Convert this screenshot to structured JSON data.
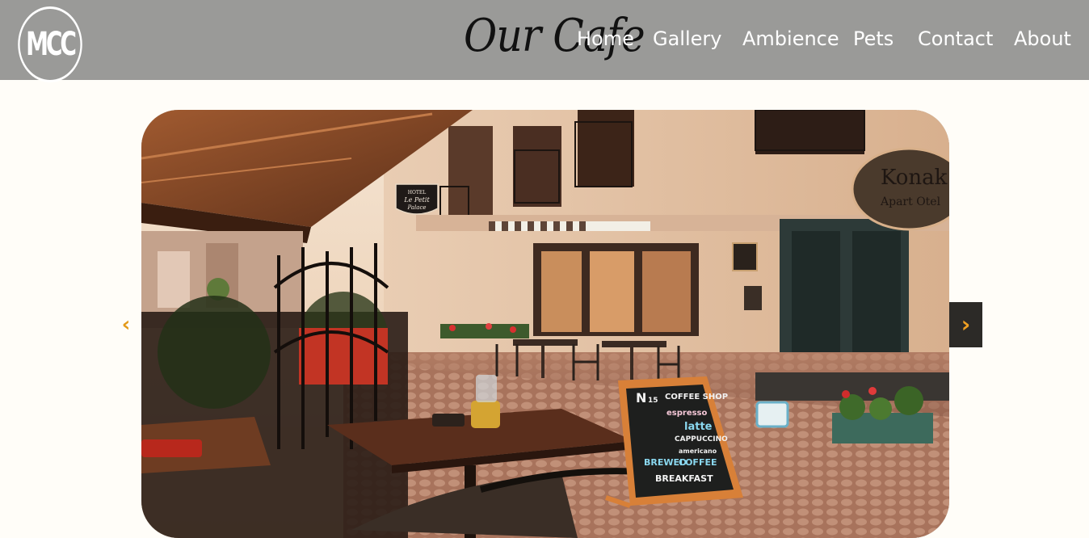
{
  "header": {
    "logo_text": "MCC",
    "title": "Our Cafe"
  },
  "nav": {
    "items": [
      {
        "label": "Home"
      },
      {
        "label": "Gallery"
      },
      {
        "label": "Ambience"
      },
      {
        "label": "Pets"
      },
      {
        "label": "Contact"
      },
      {
        "label": "About"
      }
    ]
  },
  "carousel": {
    "prev_label": "‹",
    "next_label": "›",
    "image": {
      "hotel_sign": [
        "HOTEL",
        "Le Petit",
        "Palace"
      ],
      "chalkboard": [
        "N",
        "15",
        "COFFEE SHOP",
        "espresso",
        "latte",
        "CAPPUCCINO",
        "americano",
        "BREWED",
        "COFFEE",
        "BREAKFAST"
      ],
      "round_sign": [
        "Konak",
        "Apart Otel"
      ]
    }
  },
  "colors": {
    "navbar_bg": "#9a9a98",
    "nav_text": "#ffffff",
    "arrow_accent": "#e39a1a",
    "page_bg": "#fffdf8"
  }
}
